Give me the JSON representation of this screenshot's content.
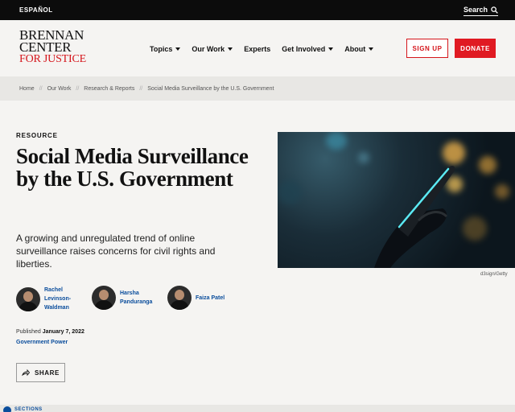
{
  "topbar": {
    "language": "ESPAÑOL",
    "search_label": "Search"
  },
  "logo": {
    "line1": "BRENNAN",
    "line2": "CENTER",
    "line3": "FOR JUSTICE"
  },
  "nav": [
    {
      "label": "Topics",
      "has_caret": true
    },
    {
      "label": "Our Work",
      "has_caret": true
    },
    {
      "label": "Experts",
      "has_caret": false
    },
    {
      "label": "Get Involved",
      "has_caret": true
    },
    {
      "label": "About",
      "has_caret": true
    }
  ],
  "buttons": {
    "signup": "SIGN UP",
    "donate": "DONATE"
  },
  "breadcrumb": [
    "Home",
    "Our Work",
    "Research & Reports",
    "Social Media Surveillance by the U.S. Government"
  ],
  "article": {
    "kicker": "RESOURCE",
    "title": "Social Media Surveillance by the U.S. Government",
    "dek": "A growing and unregulated trend of online surveillance raises concerns for civil rights and liberties.",
    "authors": [
      {
        "name": "Rachel Levinson-Waldman"
      },
      {
        "name": "Harsha Panduranga"
      },
      {
        "name": "Faiza Patel"
      }
    ],
    "published_label": "Published",
    "published_date": "January 7, 2022",
    "topic": "Government Power",
    "share_label": "SHARE"
  },
  "image": {
    "credit": "d3sign/Getty"
  },
  "bottom_bar": {
    "sections_label": "SECTIONS"
  },
  "colors": {
    "brand_red": "#e01a22",
    "link_blue": "#0a4d9c",
    "top_bar": "#0c0c0c"
  }
}
